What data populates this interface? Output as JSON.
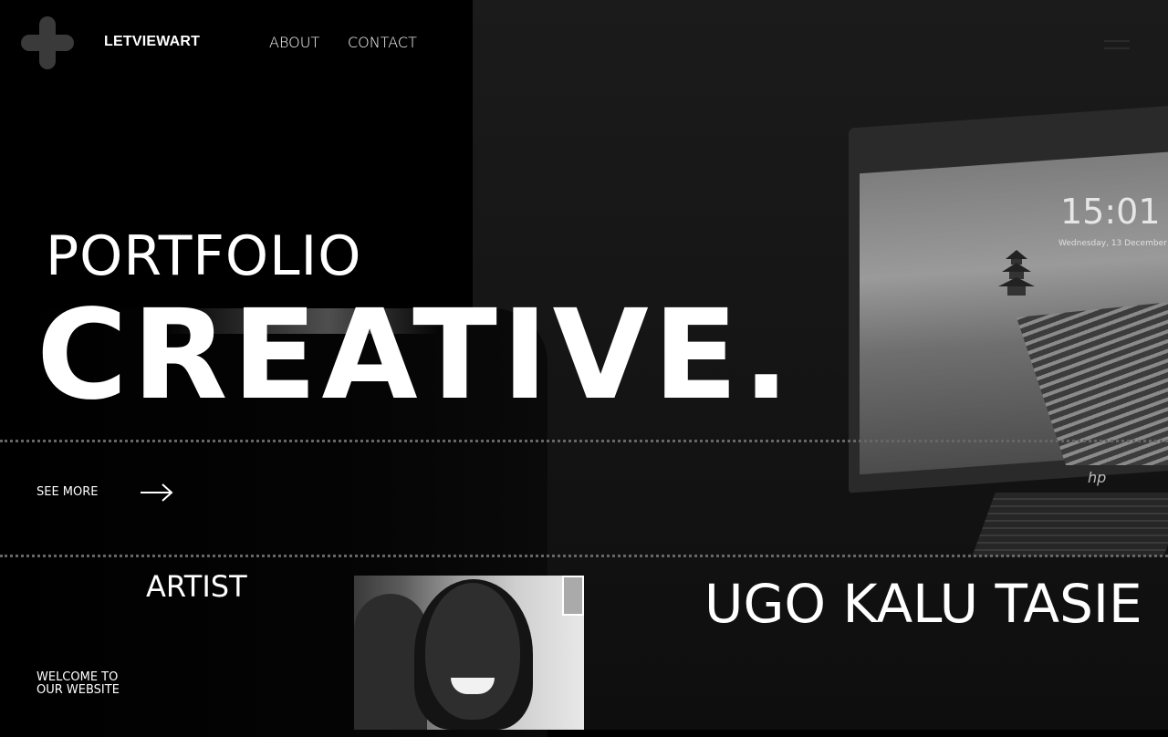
{
  "header": {
    "brand": "LETVIEWART",
    "nav": {
      "about": "ABOUT",
      "contact": "CONTACT"
    }
  },
  "hero": {
    "label": "PORTFOLIO",
    "title": "CREATIVE.",
    "see_more": "SEE MORE",
    "laptop": {
      "clock": "15:01",
      "date": "Wednesday, 13 December",
      "brand": "hp"
    }
  },
  "artist": {
    "label": "ARTIST",
    "name": "UGO KALU TASIE",
    "welcome": "WELCOME TO OUR WEBSITE"
  },
  "icons": {
    "logo": "plus-icon",
    "menu": "hamburger-menu-icon",
    "arrow": "arrow-right-icon"
  },
  "colors": {
    "background": "#000000",
    "text": "#ffffff",
    "logo": "#3a3a3a",
    "divider": "#666666"
  }
}
